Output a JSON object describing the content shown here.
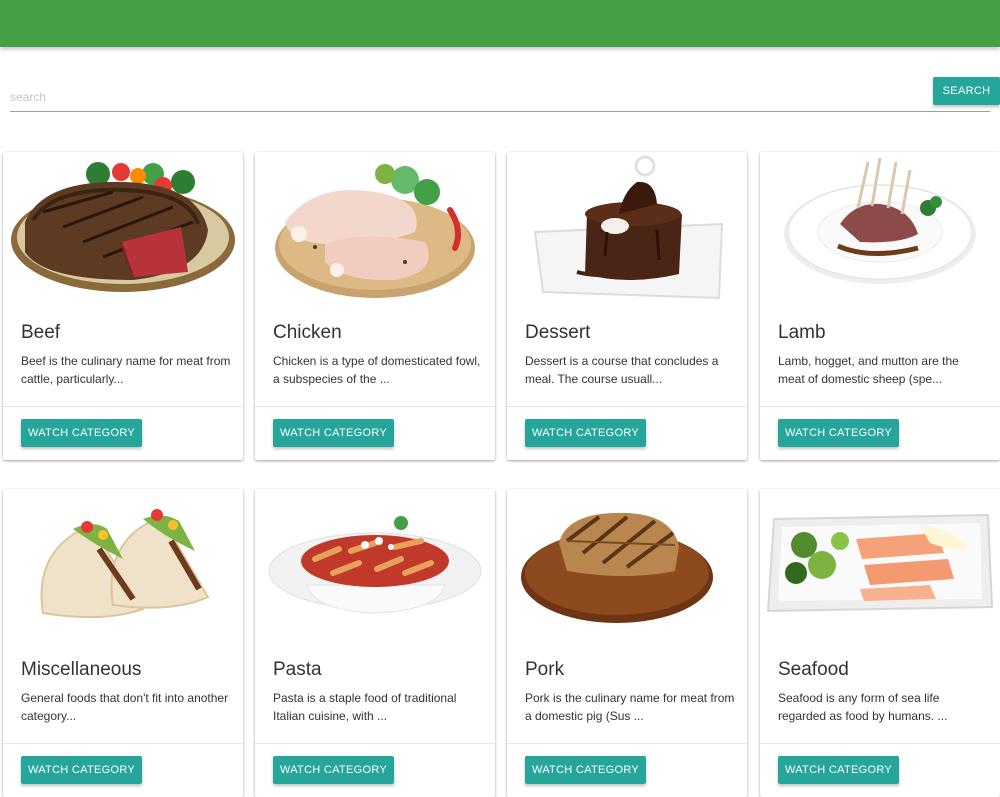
{
  "search": {
    "placeholder": "search",
    "value": "",
    "button_label": "SEARCH"
  },
  "colors": {
    "appbar": "#43a047",
    "accent": "#26a69a"
  },
  "categories": [
    {
      "title": "Beef",
      "description": "Beef is the culinary name for meat from cattle, particularly...",
      "button_label": "WATCH CATEGORY",
      "image": "beef-steak-image"
    },
    {
      "title": "Chicken",
      "description": "Chicken is a type of domesticated fowl, a subspecies of the ...",
      "button_label": "WATCH CATEGORY",
      "image": "raw-chicken-image"
    },
    {
      "title": "Dessert",
      "description": "Dessert is a course that concludes a meal. The course usuall...",
      "button_label": "WATCH CATEGORY",
      "image": "chocolate-cake-image"
    },
    {
      "title": "Lamb",
      "description": "Lamb, hogget, and mutton are the meat of domestic sheep (spe...",
      "button_label": "WATCH CATEGORY",
      "image": "lamb-rack-image"
    },
    {
      "title": "Miscellaneous",
      "description": "General foods that don't fit into another category...",
      "button_label": "WATCH CATEGORY",
      "image": "tacos-image"
    },
    {
      "title": "Pasta",
      "description": "Pasta is a staple food of traditional Italian cuisine, with ...",
      "button_label": "WATCH CATEGORY",
      "image": "penne-pasta-image"
    },
    {
      "title": "Pork",
      "description": "Pork is the culinary name for meat from a domestic pig (Sus ...",
      "button_label": "WATCH CATEGORY",
      "image": "pork-chop-image"
    },
    {
      "title": "Seafood",
      "description": "Seafood is any form of sea life regarded as food by humans. ...",
      "button_label": "WATCH CATEGORY",
      "image": "salmon-platter-image"
    }
  ]
}
